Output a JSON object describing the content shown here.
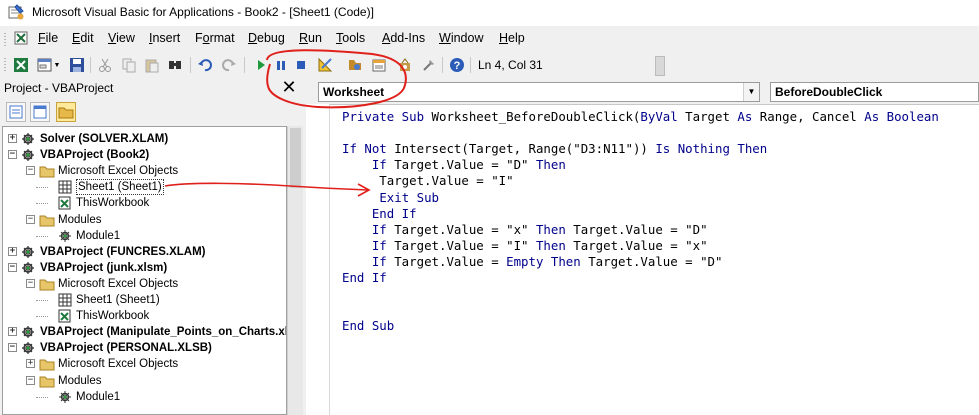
{
  "window": {
    "title": "Microsoft Visual Basic for Applications - Book2 - [Sheet1 (Code)]"
  },
  "menu": [
    {
      "pre": "",
      "acc": "F",
      "post": "ile"
    },
    {
      "pre": "",
      "acc": "E",
      "post": "dit"
    },
    {
      "pre": "",
      "acc": "V",
      "post": "iew"
    },
    {
      "pre": "",
      "acc": "I",
      "post": "nsert"
    },
    {
      "pre": "F",
      "acc": "o",
      "post": "rmat"
    },
    {
      "pre": "",
      "acc": "D",
      "post": "ebug"
    },
    {
      "pre": "",
      "acc": "R",
      "post": "un"
    },
    {
      "pre": "",
      "acc": "T",
      "post": "ools"
    },
    {
      "pre": "",
      "acc": "A",
      "post": "dd-Ins"
    },
    {
      "pre": "",
      "acc": "W",
      "post": "indow"
    },
    {
      "pre": "",
      "acc": "H",
      "post": "elp"
    }
  ],
  "toolbar": {
    "status": "Ln 4, Col 31",
    "icons": [
      "view-excel-icon",
      "insert-userform-icon",
      "save-icon",
      "cut-icon",
      "copy-icon",
      "paste-icon",
      "find-icon",
      "undo-icon",
      "redo-icon",
      "run-icon",
      "break-icon",
      "reset-icon",
      "design-mode-icon",
      "project-explorer-icon",
      "properties-window-icon",
      "object-browser-icon",
      "toolbox-icon",
      "help-icon"
    ]
  },
  "project_pane": {
    "title": "Project - VBAProject",
    "tree": [
      {
        "text": "Solver (SOLVER.XLAM)",
        "bold": true,
        "type": "project",
        "expander": "+"
      },
      {
        "text": "VBAProject (Book2)",
        "bold": true,
        "type": "project",
        "expander": "-"
      },
      {
        "text": "Microsoft Excel Objects",
        "bold": false,
        "type": "folder",
        "expander": "-"
      },
      {
        "text": "Sheet1 (Sheet1)",
        "bold": false,
        "type": "sheet",
        "expander": ""
      },
      {
        "text": "ThisWorkbook",
        "bold": false,
        "type": "workbook",
        "expander": ""
      },
      {
        "text": "Modules",
        "bold": false,
        "type": "folder",
        "expander": "-"
      },
      {
        "text": "Module1",
        "bold": false,
        "type": "module",
        "expander": ""
      },
      {
        "text": "VBAProject (FUNCRES.XLAM)",
        "bold": true,
        "type": "project",
        "expander": "+"
      },
      {
        "text": "VBAProject (junk.xlsm)",
        "bold": true,
        "type": "project",
        "expander": "-"
      },
      {
        "text": "Microsoft Excel Objects",
        "bold": false,
        "type": "folder",
        "expander": "-"
      },
      {
        "text": "Sheet1 (Sheet1)",
        "bold": false,
        "type": "sheet",
        "expander": ""
      },
      {
        "text": "ThisWorkbook",
        "bold": false,
        "type": "workbook",
        "expander": ""
      },
      {
        "text": "VBAProject (Manipulate_Points_on_Charts.xl",
        "bold": true,
        "type": "project",
        "expander": "+"
      },
      {
        "text": "VBAProject (PERSONAL.XLSB)",
        "bold": true,
        "type": "project",
        "expander": "-"
      },
      {
        "text": "Microsoft Excel Objects",
        "bold": false,
        "type": "folder",
        "expander": "+"
      },
      {
        "text": "Modules",
        "bold": false,
        "type": "folder",
        "expander": "-"
      },
      {
        "text": "Module1",
        "bold": false,
        "type": "module",
        "expander": ""
      }
    ]
  },
  "code_window": {
    "object_combo": "Worksheet",
    "procedure_combo": "BeforeDoubleClick",
    "lines": [
      [
        [
          "k",
          "Private Sub"
        ],
        [
          "t",
          " Worksheet_BeforeDoubleClick("
        ],
        [
          "k",
          "ByVal"
        ],
        [
          "t",
          " Target "
        ],
        [
          "k",
          "As"
        ],
        [
          "t",
          " Range, Cancel "
        ],
        [
          "k",
          "As Boolean"
        ]
      ],
      [],
      [
        [
          "k",
          "If Not"
        ],
        [
          "t",
          " Intersect(Target, Range(\"D3:N11\")) "
        ],
        [
          "k",
          "Is Nothing Then"
        ]
      ],
      [
        [
          "t",
          "    "
        ],
        [
          "k",
          "If"
        ],
        [
          "t",
          " Target.Value = \"D\" "
        ],
        [
          "k",
          "Then"
        ]
      ],
      [
        [
          "t",
          "     Target.Value = \"I\""
        ]
      ],
      [
        [
          "t",
          "     "
        ],
        [
          "k",
          "Exit Sub"
        ]
      ],
      [
        [
          "t",
          "    "
        ],
        [
          "k",
          "End If"
        ]
      ],
      [
        [
          "t",
          "    "
        ],
        [
          "k",
          "If"
        ],
        [
          "t",
          " Target.Value = \"x\" "
        ],
        [
          "k",
          "Then"
        ],
        [
          "t",
          " Target.Value = \"D\""
        ]
      ],
      [
        [
          "t",
          "    "
        ],
        [
          "k",
          "If"
        ],
        [
          "t",
          " Target.Value = \"I\" "
        ],
        [
          "k",
          "Then"
        ],
        [
          "t",
          " Target.Value = \"x\""
        ]
      ],
      [
        [
          "t",
          "    "
        ],
        [
          "k",
          "If"
        ],
        [
          "t",
          " Target.Value = "
        ],
        [
          "k",
          "Empty Then"
        ],
        [
          "t",
          " Target.Value = \"D\""
        ]
      ],
      [
        [
          "k",
          "End If"
        ]
      ],
      [],
      [],
      [
        [
          "k",
          "End Sub"
        ]
      ]
    ]
  },
  "colors": {
    "keyword": "#00008b",
    "annotation": "#e0201b",
    "selection_active_tool": "#ffe99a"
  }
}
